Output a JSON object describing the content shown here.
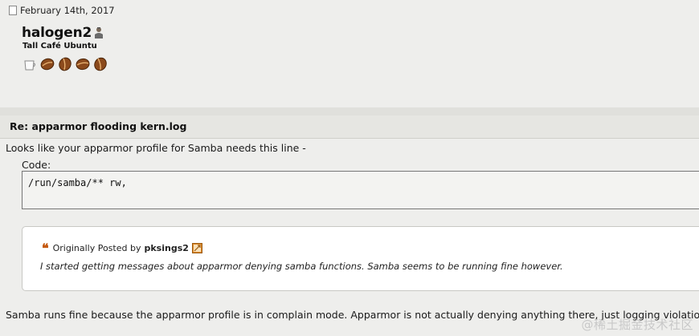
{
  "post": {
    "date": "February 14th, 2017",
    "username": "halogen2",
    "user_title": "Tall Café Ubuntu",
    "user_icon": "user-avatar-icon",
    "rank_icons": [
      "coffee-cup-icon",
      "coffee-bean-icon",
      "coffee-bean-icon",
      "coffee-bean-icon",
      "coffee-bean-icon"
    ]
  },
  "thread": {
    "title": "Re: apparmor flooding kern.log"
  },
  "message": {
    "intro": "Looks like your apparmor profile for Samba needs this line -",
    "code_label": "Code:",
    "code": "/run/samba/** rw,",
    "quote": {
      "prefix": "Originally Posted by",
      "author": "pksings2",
      "text": "I started getting messages about apparmor denying samba functions. Samba seems to be running fine however."
    },
    "reply": "Samba runs fine because the apparmor profile is in complain mode. Apparmor is not actually denying anything there, just logging violations."
  },
  "watermark": "@稀土掘金技术社区",
  "colors": {
    "background": "#eeeeec",
    "quote_accent": "#c55a11",
    "bean": "#8b4a1c"
  }
}
